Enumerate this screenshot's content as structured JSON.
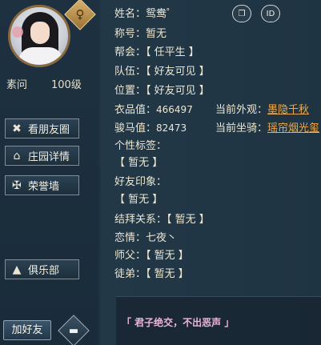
{
  "profile": {
    "name": "素问",
    "level": "100级",
    "gender_icon": "gender-badge-icon"
  },
  "side_buttons": [
    {
      "label": "看朋友圈",
      "icon": "view-moments-icon",
      "glyph": "✖"
    },
    {
      "label": "庄园详情",
      "icon": "manor-icon",
      "glyph": "🏛"
    },
    {
      "label": "荣誉墙",
      "icon": "honor-wall-icon",
      "glyph": "⛨"
    },
    {
      "label": "俱乐部",
      "icon": "club-icon",
      "glyph": "⛰"
    }
  ],
  "bottom": {
    "add_friend": "加好友",
    "chat_icon": "chat-bubble-icon"
  },
  "info": {
    "name_label": "姓名：",
    "name_value": "鸳鸯゜",
    "title_label": "称号：",
    "title_value": "暂无",
    "guild_label": "帮会：",
    "guild_value": "【 任平生 】",
    "team_label": "队伍：",
    "team_value": "【 好友可见 】",
    "location_label": "位置：",
    "location_value": "【 好友可见 】",
    "outfit_score_label": "衣品值：",
    "outfit_score_value": "466497",
    "current_look_label": "当前外观：",
    "current_look_value": "墨隐千秋",
    "mount_score_label": "骏马值：",
    "mount_score_value": "82473",
    "current_mount_label": "当前坐骑：",
    "current_mount_value": "瑶帘烟光玺",
    "tags_label": "个性标签：",
    "tags_value": "【 暂无 】",
    "impression_label": "好友印象：",
    "impression_value": "【 暂无 】",
    "sworn_label": "结拜关系：",
    "sworn_value": "【 暂无 】",
    "love_label": "恋情：",
    "love_value": "七夜丶",
    "master_label": "师父：",
    "master_value": "【 暂无 】",
    "apprentice_label": "徒弟：",
    "apprentice_value": "【 暂无 】",
    "motto": "「 君子绝交，不出恶声 」"
  },
  "top_icons": {
    "copy_icon": "copy-document-icon",
    "id_label": "ID"
  },
  "colors": {
    "accent_link": "#f3a93a",
    "motto_pink": "#e9b6d8",
    "panel_bg": "#1f3342"
  }
}
